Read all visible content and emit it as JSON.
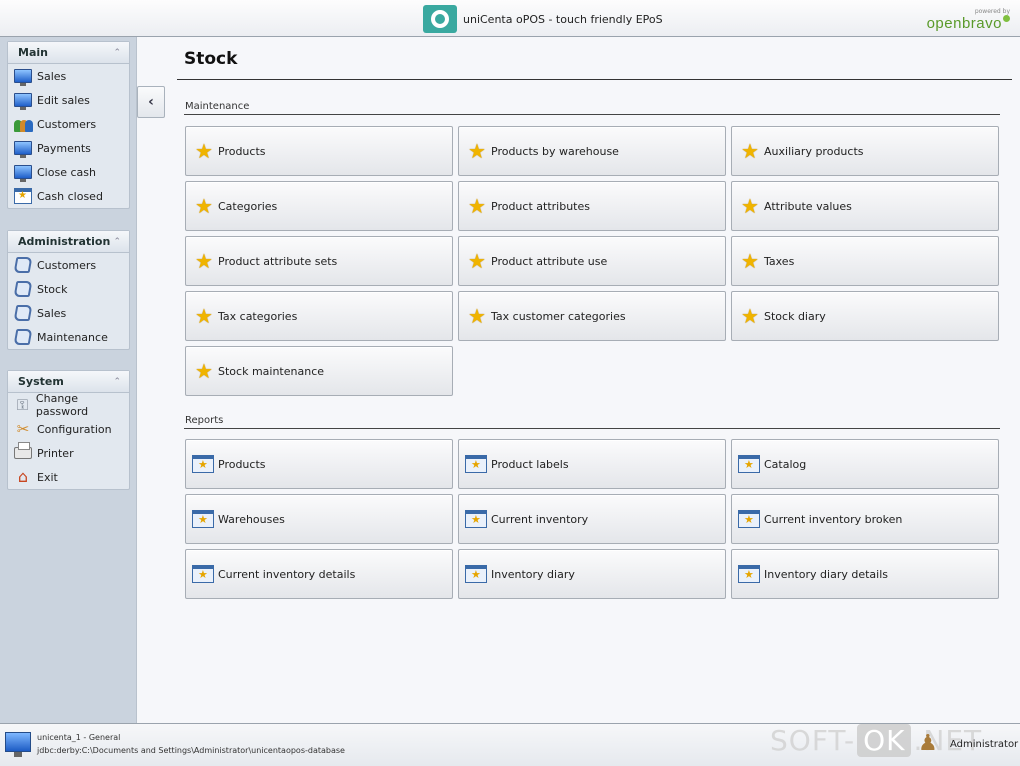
{
  "header": {
    "app_title": "uniCenta oPOS - touch friendly EPoS",
    "brand_small": "powered by",
    "brand_name": "openbravo"
  },
  "sidebar": {
    "groups": [
      {
        "title": "Main",
        "items": [
          {
            "label": "Sales",
            "icon": "monitor-icon"
          },
          {
            "label": "Edit sales",
            "icon": "monitor-icon"
          },
          {
            "label": "Customers",
            "icon": "people-icon"
          },
          {
            "label": "Payments",
            "icon": "monitor-icon"
          },
          {
            "label": "Close cash",
            "icon": "monitor-icon"
          },
          {
            "label": "Cash closed",
            "icon": "calendar-icon"
          }
        ]
      },
      {
        "title": "Administration",
        "items": [
          {
            "label": "Customers",
            "icon": "book-icon"
          },
          {
            "label": "Stock",
            "icon": "book-icon"
          },
          {
            "label": "Sales",
            "icon": "book-icon"
          },
          {
            "label": "Maintenance",
            "icon": "book-icon"
          }
        ]
      },
      {
        "title": "System",
        "items": [
          {
            "label": "Change password",
            "icon": "key-icon"
          },
          {
            "label": "Configuration",
            "icon": "tools-icon"
          },
          {
            "label": "Printer",
            "icon": "printer-icon"
          },
          {
            "label": "Exit",
            "icon": "house-icon"
          }
        ]
      }
    ]
  },
  "main": {
    "title": "Stock",
    "maintenance": {
      "label": "Maintenance",
      "items": [
        "Products",
        "Products by warehouse",
        "Auxiliary products",
        "Categories",
        "Product attributes",
        "Attribute values",
        "Product attribute sets",
        "Product attribute use",
        "Taxes",
        "Tax categories",
        "Tax customer categories",
        "Stock diary",
        "Stock maintenance"
      ]
    },
    "reports": {
      "label": "Reports",
      "items": [
        "Products",
        "Product labels",
        "Catalog",
        "Warehouses",
        "Current inventory",
        "Current inventory broken",
        "Current inventory details",
        "Inventory diary",
        "Inventory diary details"
      ]
    }
  },
  "status": {
    "line1": "unicenta_1 - General",
    "line2": "jdbc:derby:C:\\Documents and Settings\\Administrator\\unicentaopos-database",
    "user": "Administrator"
  },
  "watermark": {
    "pre": "SOFT-",
    "ok": "OK",
    "post": ".NET"
  }
}
